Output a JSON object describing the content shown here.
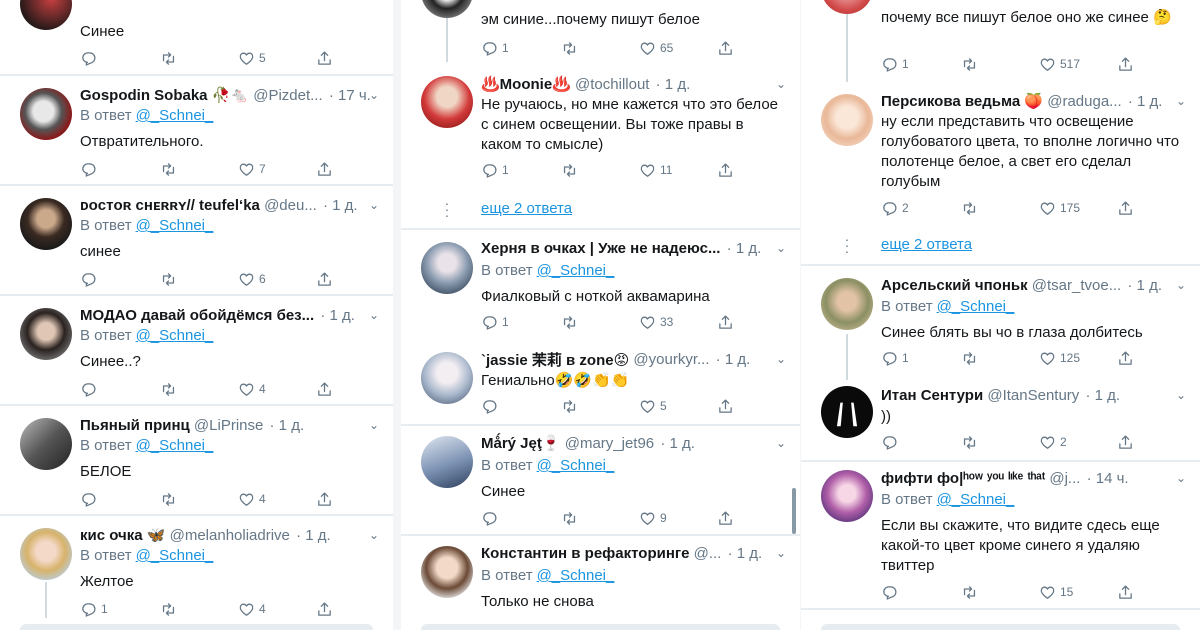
{
  "colors": {
    "link": "#1b95e0",
    "muted": "#657786",
    "text": "#14171a",
    "divider": "#e6ecf0"
  },
  "icons": {
    "reply": "reply-icon",
    "retweet": "retweet-icon",
    "like": "heart-icon",
    "share": "share-icon",
    "more": "chevron-down-icon"
  },
  "col1": {
    "t0": {
      "body": "Синее",
      "likes": "5"
    },
    "t1": {
      "name": "Gospodin Sobaka 🥀🐁",
      "handle": "@Pizdet...",
      "time": "· 17 ч.",
      "reply_prefix": "В ответ",
      "mention": "@_Schnei_",
      "body": "Отвратительного.",
      "likes": "7"
    },
    "t2": {
      "name": "ᴅᴏᴄᴛᴏʀ ᴄʜᴇʀʀʏ// teufel‘ka",
      "handle": "@deu...",
      "time": "· 1 д.",
      "reply_prefix": "В ответ",
      "mention": "@_Schnei_",
      "body": "синее",
      "likes": "6"
    },
    "t3": {
      "name": "МОДАО давай обойдёмся без...",
      "handle": "",
      "time": "· 1 д.",
      "reply_prefix": "В ответ",
      "mention": "@_Schnei_",
      "body": "Синее..?",
      "likes": "4"
    },
    "t4": {
      "name": "Пьяный принц",
      "handle": "@LiPrinse",
      "time": "· 1 д.",
      "reply_prefix": "В ответ",
      "mention": "@_Schnei_",
      "body": "БЕЛОЕ",
      "likes": "4"
    },
    "t5": {
      "name": "кис очка 🦋",
      "handle": "@melanholiadrive",
      "time": "· 1 д.",
      "reply_prefix": "В ответ",
      "mention": "@_Schnei_",
      "body": "Желтое",
      "replies": "1",
      "likes": "4"
    }
  },
  "col2": {
    "t0": {
      "body": "эм синие...почему пишут белое",
      "replies": "1",
      "likes": "65"
    },
    "t1": {
      "name": "♨️Moonie♨️",
      "handle": "@tochillout",
      "time": "· 1 д.",
      "body": "Не ручаюсь, но мне кажется что это белое с синем освещении. Вы тоже правы в каком то смысле)",
      "replies": "1",
      "likes": "11"
    },
    "more": "еще 2 ответа",
    "t2": {
      "name": "Херня в очках | Уже не надеюс...",
      "handle": "",
      "time": "· 1 д.",
      "reply_prefix": "В ответ",
      "mention": "@_Schnei_",
      "body": "Фиалковый с ноткой аквамарина",
      "replies": "1",
      "likes": "33"
    },
    "t3": {
      "name": "`jassie 茉莉 в zone😡",
      "handle": "@yourkyr...",
      "time": "· 1 д.",
      "body": "Гениально🤣🤣👏👏",
      "likes": "5"
    },
    "t4": {
      "name": "Mǻrý Jęţ🍷",
      "handle": "@mary_jet96",
      "time": "· 1 д.",
      "reply_prefix": "В ответ",
      "mention": "@_Schnei_",
      "body": "Синее",
      "likes": "9"
    },
    "t5": {
      "name": "Константин в рефакторинге",
      "handle": "@...",
      "time": "· 1 д.",
      "reply_prefix": "В ответ",
      "mention": "@_Schnei_",
      "body": "Только не снова"
    }
  },
  "col3": {
    "t0": {
      "body": "почему все пишут белое оно же синее 🤔",
      "replies": "1",
      "likes": "517"
    },
    "t1": {
      "name": "Персикова ведьма 🍑",
      "handle": "@raduga...",
      "time": "· 1 д.",
      "body": "ну если представить что освещение голубоватого цвета, то вполне логично что полотенце белое, а свет его сделал голубым",
      "replies": "2",
      "likes": "175"
    },
    "more": "еще 2 ответа",
    "t2": {
      "name": "Арсельский чпоньк",
      "handle": "@tsar_tvoe...",
      "time": "· 1 д.",
      "reply_prefix": "В ответ",
      "mention": "@_Schnei_",
      "body": "Синее блять вы чо в глаза долбитесь",
      "replies": "1",
      "likes": "125"
    },
    "t3": {
      "name": "Итан Сентури",
      "handle": "@ItanSentury",
      "time": "· 1 д.",
      "body": "))",
      "likes": "2"
    },
    "t4": {
      "name": "фифти фо|ʰᵒʷ ʸᵒᵘ ˡᶦᵏᵉ ᵗʰᵃᵗ",
      "handle": "@j...",
      "time": "· 14 ч.",
      "reply_prefix": "В ответ",
      "mention": "@_Schnei_",
      "body": "Если вы скажите, что видите сдесь еще какой-то цвет кроме синего я удаляю твиттер",
      "likes": "15"
    }
  }
}
